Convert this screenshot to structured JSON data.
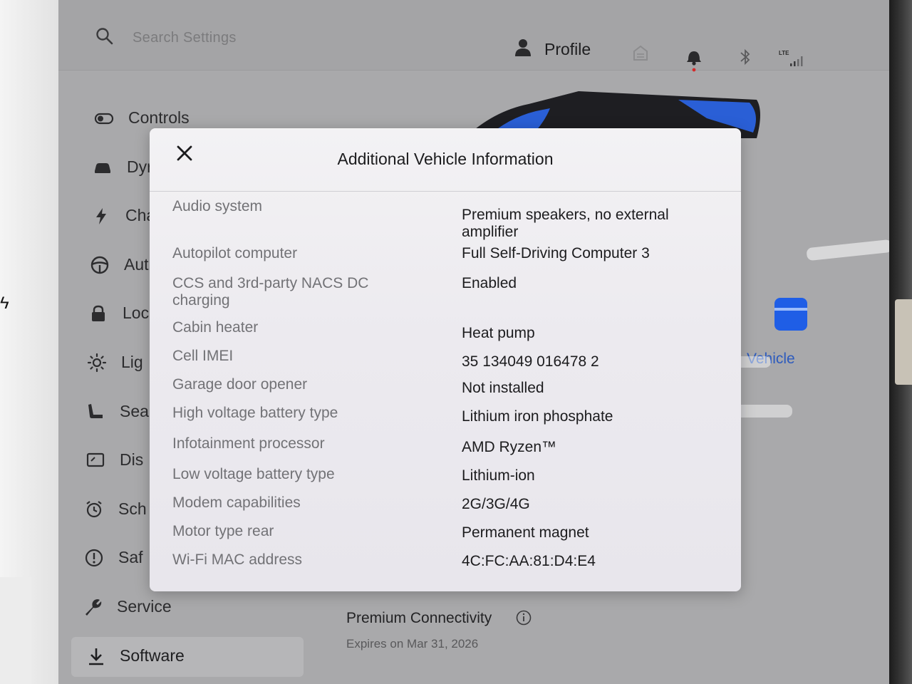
{
  "topbar": {
    "search_placeholder": "Search Settings",
    "profile_label": "Profile",
    "lte_label": "LTE"
  },
  "sidebar": {
    "items": [
      {
        "label": "Controls",
        "icon": "toggle-icon"
      },
      {
        "label": "Dyr",
        "icon": "car-icon"
      },
      {
        "label": "Cha",
        "icon": "bolt-icon"
      },
      {
        "label": "Aut",
        "icon": "steering-wheel-icon"
      },
      {
        "label": "Loc",
        "icon": "lock-icon"
      },
      {
        "label": "Lig",
        "icon": "sun-icon"
      },
      {
        "label": "Sea",
        "icon": "seat-icon"
      },
      {
        "label": "Dis",
        "icon": "display-icon"
      },
      {
        "label": "Sch",
        "icon": "alarm-clock-icon"
      },
      {
        "label": "Saf",
        "icon": "alert-circle-icon"
      },
      {
        "label": "Service",
        "icon": "wrench-icon"
      },
      {
        "label": "Software",
        "icon": "download-icon"
      }
    ]
  },
  "main": {
    "vehicle_link": "Vehicle",
    "premium_connectivity": "Premium Connectivity",
    "expires": "Expires on Mar 31, 2026",
    "accent_color": "#1f5ee6"
  },
  "modal": {
    "title": "Additional Vehicle Information",
    "rows": [
      {
        "key": "Audio system",
        "value": "Premium speakers, no external amplifier"
      },
      {
        "key": "Autopilot computer",
        "value": "Full Self-Driving Computer 3"
      },
      {
        "key": "CCS and 3rd-party NACS DC charging",
        "value": "Enabled"
      },
      {
        "key": "Cabin heater",
        "value": "Heat pump"
      },
      {
        "key": "Cell IMEI",
        "value": "35 134049 016478 2"
      },
      {
        "key": "Garage door opener",
        "value": "Not installed"
      },
      {
        "key": "High voltage battery type",
        "value": "Lithium iron phosphate"
      },
      {
        "key": "Infotainment processor",
        "value": "AMD Ryzen™"
      },
      {
        "key": "Low voltage battery type",
        "value": "Lithium-ion"
      },
      {
        "key": "Modem capabilities",
        "value": "2G/3G/4G"
      },
      {
        "key": "Motor type rear",
        "value": "Permanent magnet"
      },
      {
        "key": "Wi-Fi MAC address",
        "value": "4C:FC:AA:81:D4:E4"
      }
    ]
  }
}
